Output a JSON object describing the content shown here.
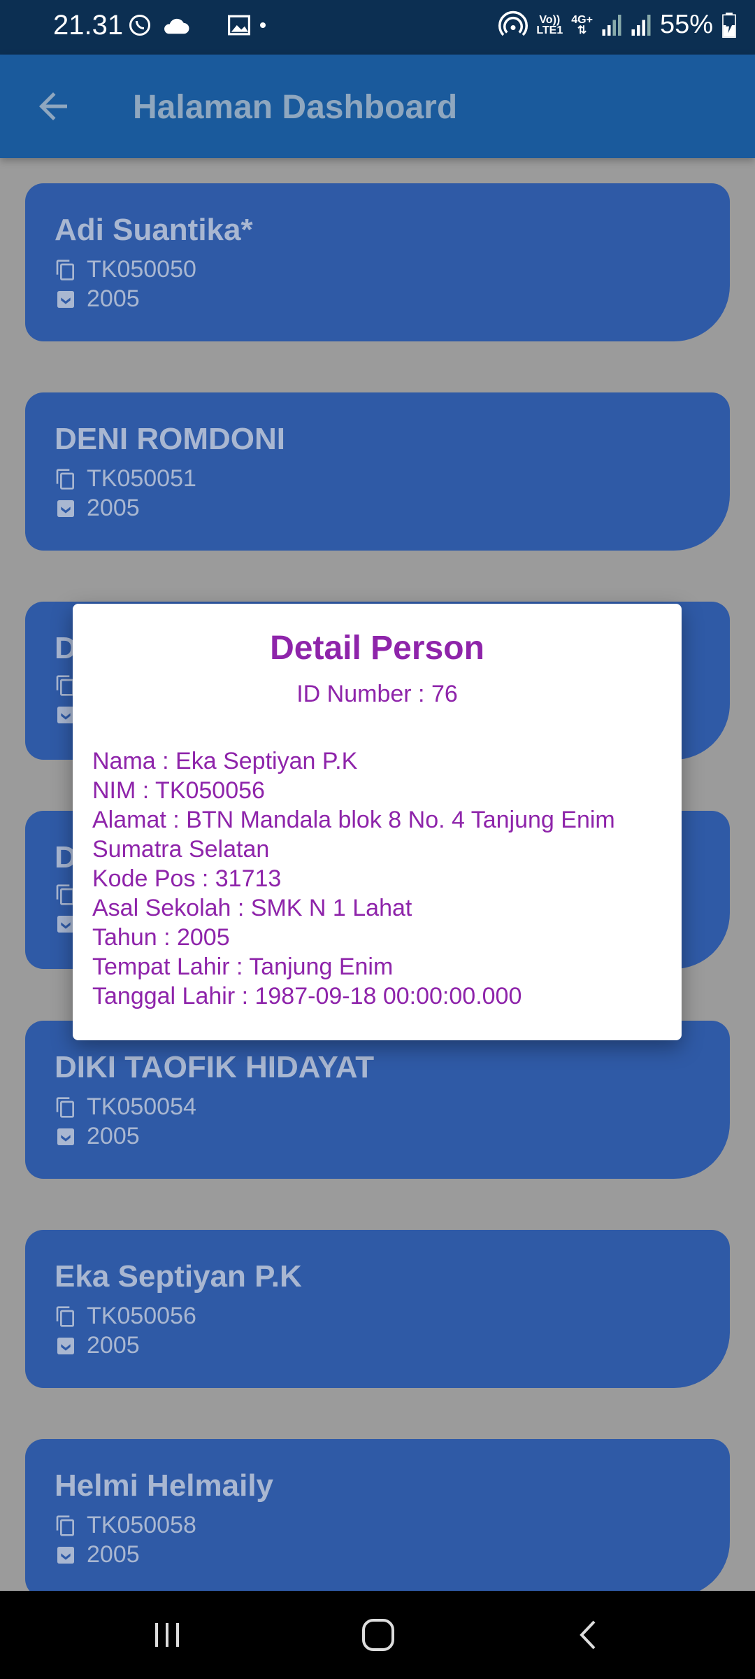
{
  "status_bar": {
    "time": "21.31",
    "battery": "55%",
    "network": "4G+",
    "lte_top": "Vo))",
    "lte_bottom": "LTE1"
  },
  "app_bar": {
    "title": "Halaman Dashboard"
  },
  "cards": [
    {
      "name": "Adi Suantika*",
      "nim": "TK050050",
      "year": "2005"
    },
    {
      "name": "DENI ROMDONI",
      "nim": "TK050051",
      "year": "2005"
    },
    {
      "name": "D",
      "nim": "",
      "year": ""
    },
    {
      "name": "D",
      "nim": "",
      "year": ""
    },
    {
      "name": "DIKI TAOFIK HIDAYAT",
      "nim": "TK050054",
      "year": "2005"
    },
    {
      "name": "Eka Septiyan P.K",
      "nim": "TK050056",
      "year": "2005"
    },
    {
      "name": "Helmi Helmaily",
      "nim": "TK050058",
      "year": "2005"
    }
  ],
  "dialog": {
    "title": "Detail Person",
    "id_line": "ID Number : 76",
    "lines": [
      "Nama : Eka Septiyan P.K",
      "NIM : TK050056",
      "Alamat : BTN Mandala blok 8 No. 4 Tanjung Enim Sumatra Selatan",
      "Kode Pos : 31713",
      "Asal Sekolah : SMK N 1 Lahat",
      "Tahun : 2005",
      "Tempat Lahir : Tanjung Enim",
      "Tanggal Lahir : 1987-09-18 00:00:00.000"
    ]
  },
  "colors": {
    "app_bar": "#1a5a9c",
    "card": "#2f5aa6",
    "dialog_text": "#8e24aa",
    "status_bar": "#0c2f52"
  }
}
